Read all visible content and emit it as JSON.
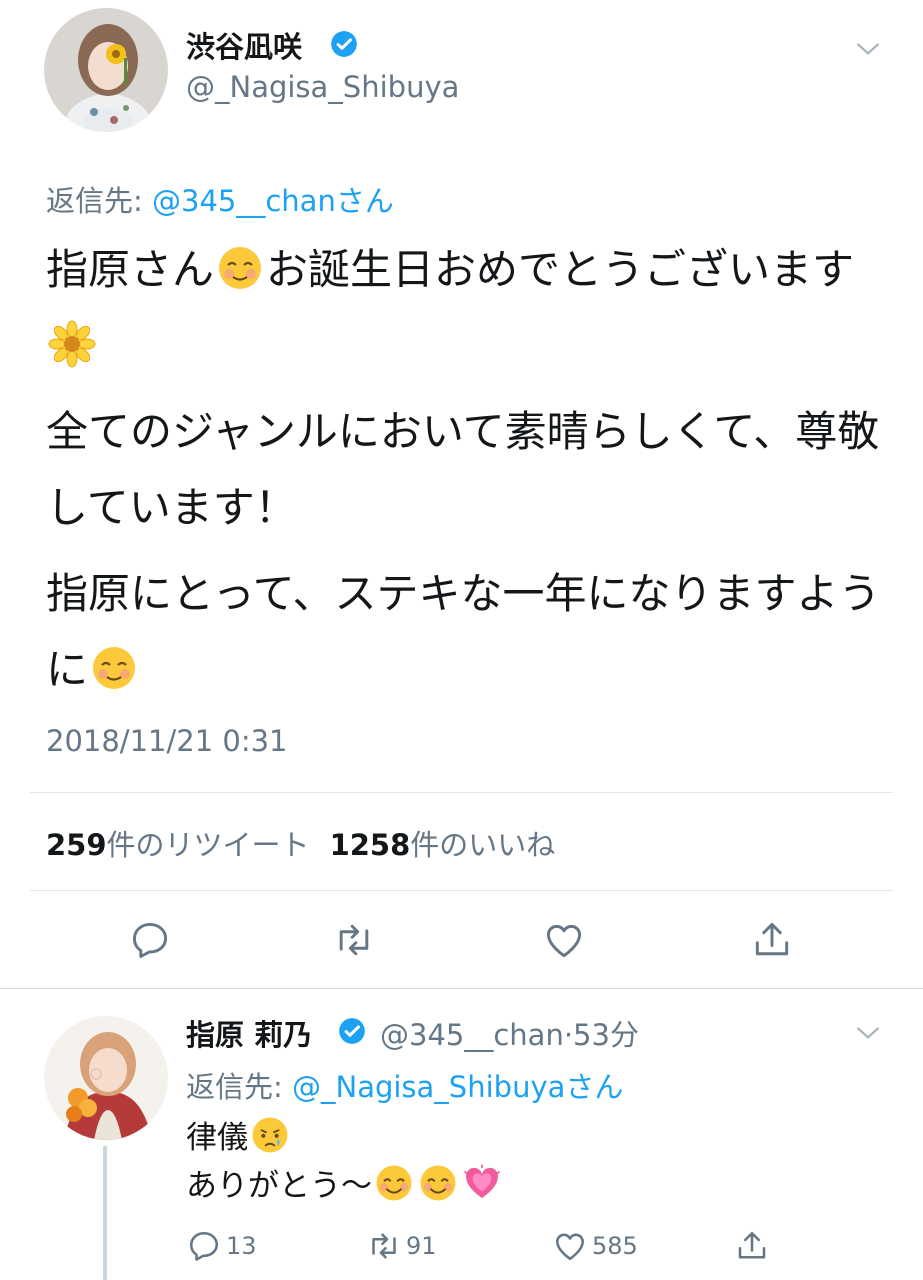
{
  "main_tweet": {
    "display_name": "渋谷凪咲",
    "handle": "@_Nagisa_Shibuya",
    "reply_to_prefix": "返信先: ",
    "reply_to_mention": "@345__chanさん",
    "body": {
      "line1_a": "指原さん",
      "line1_b": "お誕生日おめでとうございます",
      "line2": "全てのジャンルにおいて素晴らしくて、尊敬しています！",
      "line3": "指原にとって、ステキな一年になりますように"
    },
    "timestamp": "2018/11/21 0:31",
    "retweet_count": "259",
    "retweet_label": "件のリツイート",
    "like_count": "1258",
    "like_label": "件のいいね"
  },
  "reply_tweet": {
    "display_name": "指原 莉乃",
    "handle_time": "@345__chan·53分",
    "reply_to_prefix": "返信先: ",
    "reply_to_mention": "@_Nagisa_Shibuyaさん",
    "line1": "律儀",
    "line2": "ありがとう〜",
    "reply_count": "13",
    "retweet_count": "91",
    "like_count": "585"
  },
  "icons": {
    "verified": "verified-badge-icon",
    "caret": "chevron-down-icon",
    "reply": "reply-icon",
    "retweet": "retweet-icon",
    "like": "heart-icon",
    "share": "share-icon",
    "emoji_relieved": "relieved-face-emoji",
    "emoji_blossom": "blossom-emoji",
    "emoji_crying": "crying-face-emoji",
    "emoji_blush": "smiling-face-emoji",
    "emoji_heart": "growing-heart-emoji"
  },
  "colors": {
    "link": "#1da1f2",
    "secondary_text": "#657786",
    "primary_text": "#14171a"
  }
}
